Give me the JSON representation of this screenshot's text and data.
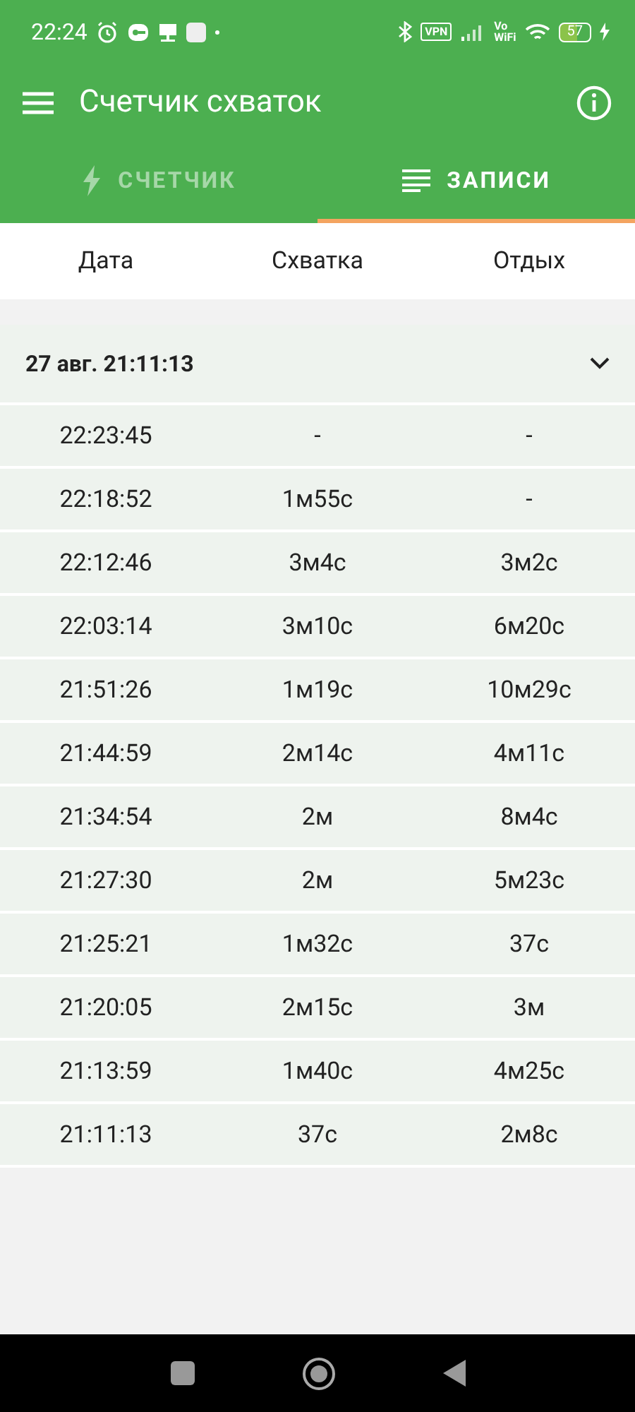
{
  "status_bar": {
    "time": "22:24",
    "vpn": "VPN",
    "volte_top": "Vo",
    "volte_bottom": "WiFi",
    "battery": "57"
  },
  "app_bar": {
    "title": "Счетчик схваток"
  },
  "tabs": [
    {
      "label": "СЧЕТЧИК",
      "selected": false
    },
    {
      "label": "ЗАПИСИ",
      "selected": true
    }
  ],
  "table": {
    "columns": [
      "Дата",
      "Схватка",
      "Отдых"
    ],
    "groups": [
      {
        "title": "27 авг. 21:11:13",
        "expanded": true,
        "rows": [
          [
            "22:23:45",
            "-",
            "-"
          ],
          [
            "22:18:52",
            "1м55с",
            "-"
          ],
          [
            "22:12:46",
            "3м4с",
            "3м2с"
          ],
          [
            "22:03:14",
            "3м10с",
            "6м20с"
          ],
          [
            "21:51:26",
            "1м19с",
            "10м29с"
          ],
          [
            "21:44:59",
            "2м14с",
            "4м11с"
          ],
          [
            "21:34:54",
            "2м",
            "8м4с"
          ],
          [
            "21:27:30",
            "2м",
            "5м23с"
          ],
          [
            "21:25:21",
            "1м32с",
            "37с"
          ],
          [
            "21:20:05",
            "2м15с",
            "3м"
          ],
          [
            "21:13:59",
            "1м40с",
            "4м25с"
          ],
          [
            "21:11:13",
            "37с",
            "2м8с"
          ]
        ]
      }
    ]
  }
}
